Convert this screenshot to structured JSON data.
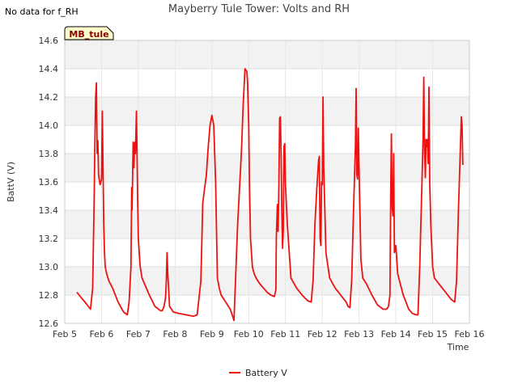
{
  "no_data_note": "No data for f_RH",
  "chart_data": {
    "type": "line",
    "title": "Mayberry Tule Tower: Volts and RH",
    "xlabel": "Time",
    "ylabel": "BattV (V)",
    "site_label": "MB_tule",
    "ylim": [
      12.6,
      14.6
    ],
    "yticks": [
      12.6,
      12.8,
      13.0,
      13.2,
      13.4,
      13.6,
      13.8,
      14.0,
      14.2,
      14.4,
      14.6
    ],
    "xlim": [
      5,
      16
    ],
    "xticks": [
      5,
      6,
      7,
      8,
      9,
      10,
      11,
      12,
      13,
      14,
      15,
      16
    ],
    "xtick_labels": [
      "Feb 5",
      "Feb 6",
      "Feb 7",
      "Feb 8",
      "Feb 9",
      "Feb 10",
      "Feb 11",
      "Feb 12",
      "Feb 13",
      "Feb 14",
      "Feb 15",
      "Feb 16"
    ],
    "grid": true,
    "legend_position": "bottom",
    "series": [
      {
        "name": "Battery V",
        "color": "#ee1111",
        "x": [
          5.33,
          5.45,
          5.55,
          5.64,
          5.7,
          5.76,
          5.8,
          5.82,
          5.84,
          5.86,
          5.88,
          5.9,
          5.92,
          5.96,
          6.0,
          6.02,
          6.04,
          6.06,
          6.08,
          6.1,
          6.14,
          6.2,
          6.3,
          6.45,
          6.6,
          6.7,
          6.75,
          6.8,
          6.81,
          6.82,
          6.83,
          6.84,
          6.86,
          6.88,
          6.9,
          6.92,
          6.95,
          6.98,
          7.0,
          7.05,
          7.1,
          7.2,
          7.3,
          7.45,
          7.6,
          7.65,
          7.7,
          7.72,
          7.74,
          7.76,
          7.78,
          7.8,
          7.85,
          7.95,
          8.1,
          8.3,
          8.5,
          8.6,
          8.7,
          8.75,
          8.8,
          8.85,
          8.9,
          8.95,
          9.0,
          9.05,
          9.1,
          9.15,
          9.2,
          9.25,
          9.3,
          9.4,
          9.5,
          9.6,
          9.7,
          9.75,
          9.8,
          9.85,
          9.9,
          9.95,
          9.97,
          10.0,
          10.02,
          10.05,
          10.1,
          10.15,
          10.2,
          10.3,
          10.4,
          10.5,
          10.6,
          10.7,
          10.74,
          10.75,
          10.78,
          10.8,
          10.82,
          10.84,
          10.86,
          10.88,
          10.9,
          10.92,
          10.94,
          10.96,
          10.98,
          11.0,
          11.05,
          11.15,
          11.3,
          11.45,
          11.6,
          11.7,
          11.75,
          11.8,
          11.85,
          11.9,
          11.92,
          11.94,
          11.96,
          11.98,
          12.0,
          12.02,
          12.04,
          12.1,
          12.2,
          12.35,
          12.5,
          12.65,
          12.7,
          12.75,
          12.8,
          12.85,
          12.9,
          12.92,
          12.94,
          12.96,
          12.98,
          13.0,
          13.02,
          13.05,
          13.1,
          13.2,
          13.35,
          13.5,
          13.65,
          13.75,
          13.8,
          13.82,
          13.84,
          13.86,
          13.88,
          13.9,
          13.92,
          13.94,
          13.96,
          13.98,
          14.0,
          14.05,
          14.1,
          14.15,
          14.2,
          14.35,
          14.45,
          14.55,
          14.6,
          14.65,
          14.7,
          14.72,
          14.74,
          14.76,
          14.78,
          14.8,
          14.82,
          14.84,
          14.86,
          14.88,
          14.9,
          14.92,
          14.95,
          15.0,
          15.05,
          15.2,
          15.35,
          15.5,
          15.6,
          15.65,
          15.7,
          15.75,
          15.78,
          15.8,
          15.82
        ],
        "y": [
          12.82,
          12.78,
          12.75,
          12.72,
          12.7,
          12.85,
          13.5,
          13.9,
          14.2,
          14.3,
          13.8,
          13.89,
          13.65,
          13.58,
          13.62,
          14.1,
          13.7,
          13.3,
          13.1,
          13.0,
          12.95,
          12.9,
          12.85,
          12.75,
          12.68,
          12.66,
          12.75,
          13.0,
          13.3,
          13.56,
          13.4,
          13.55,
          13.88,
          13.7,
          13.88,
          13.8,
          14.1,
          13.5,
          13.2,
          13.0,
          12.92,
          12.86,
          12.8,
          12.72,
          12.69,
          12.69,
          12.72,
          12.75,
          12.78,
          12.9,
          13.1,
          12.95,
          12.72,
          12.68,
          12.67,
          12.66,
          12.65,
          12.66,
          12.9,
          13.45,
          13.55,
          13.65,
          13.85,
          14.0,
          14.07,
          14.0,
          13.6,
          12.92,
          12.85,
          12.8,
          12.78,
          12.74,
          12.7,
          12.62,
          13.3,
          13.55,
          13.8,
          14.15,
          14.4,
          14.38,
          14.3,
          14.0,
          13.6,
          13.2,
          13.0,
          12.95,
          12.92,
          12.88,
          12.85,
          12.82,
          12.8,
          12.79,
          12.84,
          13.2,
          13.44,
          13.25,
          13.55,
          14.05,
          14.06,
          13.8,
          13.4,
          13.13,
          13.25,
          13.85,
          13.87,
          13.58,
          13.3,
          12.92,
          12.85,
          12.8,
          12.76,
          12.75,
          12.9,
          13.3,
          13.55,
          13.75,
          13.78,
          13.2,
          13.15,
          13.6,
          13.58,
          14.2,
          13.7,
          13.1,
          12.92,
          12.85,
          12.8,
          12.75,
          12.72,
          12.71,
          12.9,
          13.4,
          13.85,
          14.26,
          13.65,
          13.62,
          13.98,
          13.7,
          13.45,
          13.05,
          12.92,
          12.88,
          12.8,
          12.73,
          12.7,
          12.7,
          12.72,
          12.76,
          12.8,
          13.5,
          13.94,
          13.42,
          13.36,
          13.8,
          13.1,
          13.12,
          13.15,
          12.95,
          12.9,
          12.85,
          12.8,
          12.7,
          12.67,
          12.66,
          12.66,
          13.0,
          13.5,
          13.7,
          13.9,
          14.34,
          13.85,
          13.63,
          13.9,
          13.85,
          13.9,
          13.73,
          14.27,
          13.6,
          13.3,
          13.0,
          12.92,
          12.87,
          12.82,
          12.77,
          12.75,
          12.9,
          13.4,
          13.8,
          14.06,
          14.0,
          13.72
        ]
      }
    ]
  }
}
